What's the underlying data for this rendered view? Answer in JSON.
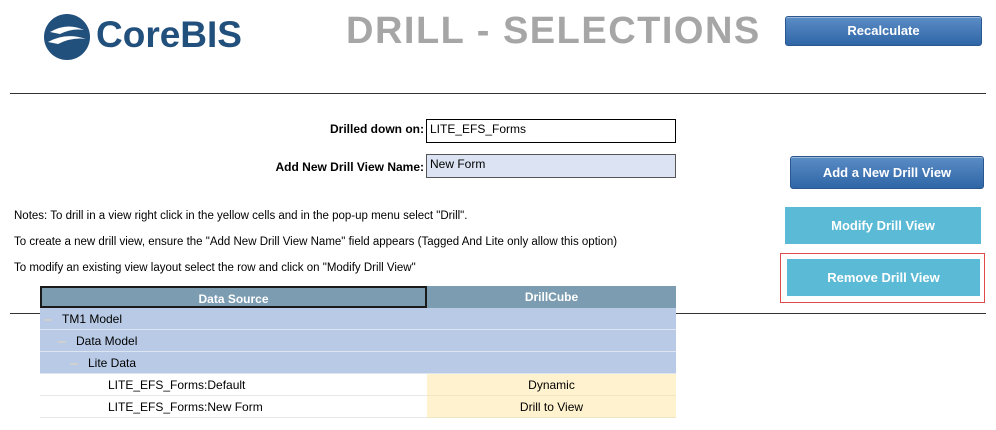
{
  "header": {
    "logo_text": "CoreBIS",
    "title": "DRILL - SELECTIONS",
    "recalculate_label": "Recalculate"
  },
  "form": {
    "drilled_label": "Drilled down on:",
    "drilled_value": "LITE_EFS_Forms",
    "new_name_label": "Add New Drill View Name:",
    "new_name_value": "New Form"
  },
  "buttons": {
    "add": "Add a New Drill View",
    "modify": "Modify Drill View",
    "remove": "Remove Drill View"
  },
  "notes": [
    "Notes: To drill in a view right click in the yellow cells and in the pop-up menu select \"Drill\".",
    "To create a new drill view, ensure the \"Add New Drill View Name\" field appears (Tagged And Lite only allow this option)",
    "To modify an existing view layout select the row and click on \"Modify Drill View\""
  ],
  "table": {
    "headers": [
      "Data Source",
      "DrillCube"
    ],
    "rows": [
      {
        "label": "TM1 Model",
        "value": ""
      },
      {
        "label": "Data Model",
        "value": ""
      },
      {
        "label": "Lite Data",
        "value": ""
      },
      {
        "label": "LITE_EFS_Forms:Default",
        "value": "Dynamic"
      },
      {
        "label": "LITE_EFS_Forms:New Form",
        "value": "Drill to View"
      }
    ]
  },
  "colors": {
    "brand": "#22507c",
    "button_dark": "#3a72b3",
    "button_light": "#5bbad5",
    "header_fill": "#7c9cb1",
    "tree_fill": "#b8cae5",
    "yellow_cell": "#fff3cf",
    "highlight_border": "#e04a4a"
  }
}
